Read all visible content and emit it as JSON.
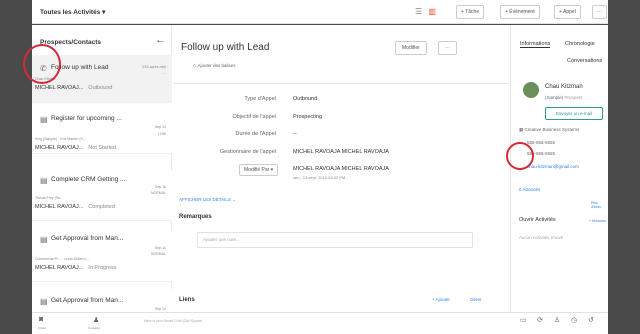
{
  "topbar": {
    "title": "Toutes les Activités",
    "buttons": [
      "+ Tâche",
      "+ Événement",
      "+ Appel",
      "···"
    ]
  },
  "left": {
    "header": "Prospects/Contacts",
    "items": [
      {
        "title": "Follow up with Lead",
        "time": "3:52 après-midi",
        "priority": "···",
        "names": "Chau Kitzma...",
        "who": "MICHEL RAVOAJ...",
        "status": "Outbound"
      },
      {
        "title": "Register for upcoming ...",
        "time": "Sep 13",
        "priority": "LOW",
        "names": "King (Sample) · Kris Marrier (S...",
        "who": "MICHEL RAVOAJ...",
        "status": "Not Started"
      },
      {
        "title": "Complete CRM Getting ...",
        "time": "Sep 16",
        "priority": "NORMAL",
        "names": "Theola Frey (Sa...",
        "who": "MICHEL RAVOAJ...",
        "status": "Completed"
      },
      {
        "title": "Get Approval from Man...",
        "time": "Sep 14",
        "priority": "NORMAL",
        "names": "Commercial Pr... · Leota Dilliard (...",
        "who": "MICHEL RAVOAJ...",
        "status": "In Progress"
      },
      {
        "title": "Get Approval from Man...",
        "time": "Sep 14",
        "priority": "",
        "names": "",
        "who": "",
        "status": ""
      }
    ]
  },
  "center": {
    "subject": "Follow up with Lead",
    "tags": "Ajouter des balises",
    "modify": "Modifier",
    "more": "···",
    "fields": [
      {
        "label": "Type d'Appel",
        "value": "Outbound"
      },
      {
        "label": "Objectif de l'appel",
        "value": "Prospecting"
      },
      {
        "label": "Durée de l'Appel",
        "value": "--"
      },
      {
        "label": "Gestionnaire de l'appel",
        "value": "MICHEL RAVOAJA MICHEL RAVOAJA"
      }
    ],
    "modified_by_label": "Modifié Par",
    "modified_by_name": "MICHEL RAVOAJA MICHEL RAVOAJA",
    "modified_by_date": "ven., 13 sept. 2019 03:02 PM",
    "show_details": "AFFICHER LES DÉTAILS",
    "remarks": "Remarques",
    "note_placeholder": "Ajouter une note...",
    "links": "Liens",
    "links_add": "+ Ajouter",
    "links_manage": "Gérer"
  },
  "right": {
    "tabs": [
      "Informations",
      "Chronologie",
      "Conversations"
    ],
    "contact_name": "Chau Kitzman",
    "contact_sample": "(Sample)",
    "contact_type": "Prospect",
    "email_btn": "Envoyer un e-mail",
    "company": "Creative Business Systems",
    "phone1": "555-555-5555",
    "phone2": "555-555-5555",
    "email": "chau-kitzman@gmail.com",
    "followers": "0 Abonnés",
    "more_info": "Plus d'infos",
    "open_activities": "Ouvrir Activités",
    "new_link": "+ Nouveau",
    "no_activities": "Aucun Activités trouvé"
  },
  "bottom": {
    "labels": [
      "Chats",
      "Contacts"
    ],
    "hint": "Here is your Smart Chat (Ctrl+Space)"
  }
}
